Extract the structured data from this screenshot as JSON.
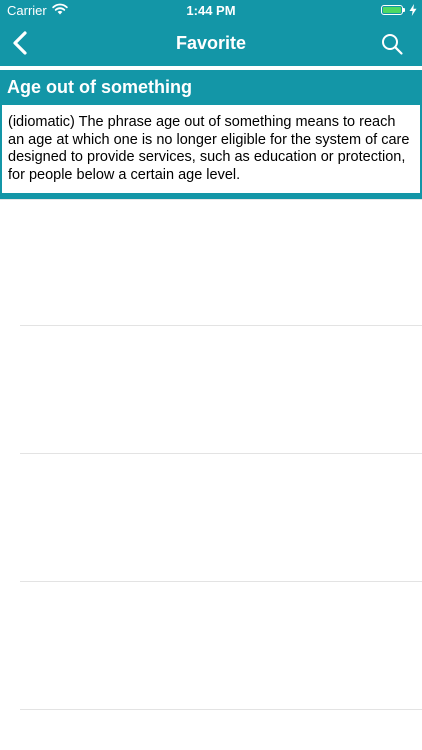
{
  "status_bar": {
    "carrier": "Carrier",
    "time": "1:44 PM",
    "wifi_icon": "wifi-icon",
    "battery_icon": "battery-icon",
    "charging_icon": "bolt-icon",
    "battery_level": 1.0
  },
  "nav": {
    "title": "Favorite",
    "back_icon": "chevron-left-icon",
    "search_icon": "search-icon"
  },
  "entry": {
    "title": "Age out of something",
    "definition": "(idiomatic) The phrase age out of something means to reach an age at which one is no longer eligible for the system of care designed to provide services, such as education or protection, for people below a certain age level."
  },
  "colors": {
    "accent": "#1396a7",
    "battery_green": "#4cd964",
    "separator": "#e3e3e3"
  }
}
